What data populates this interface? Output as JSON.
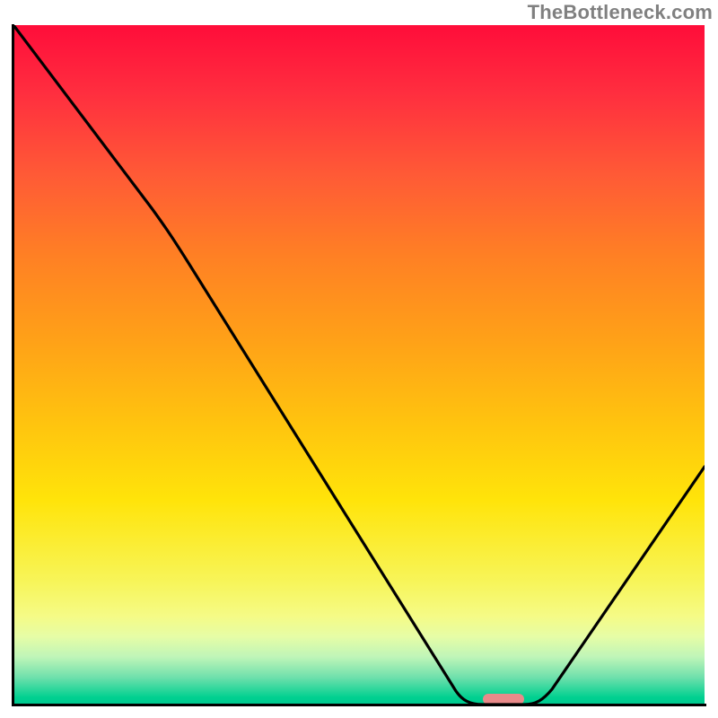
{
  "watermark": "TheBottleneck.com",
  "colors": {
    "gradient_top": "#ff0d3a",
    "gradient_bottom": "#00c890",
    "axis": "#000000",
    "curve": "#000000",
    "marker": "#e98a8a",
    "watermark": "#808080"
  },
  "chart_data": {
    "type": "line",
    "title": "",
    "xlabel": "",
    "ylabel": "",
    "xlim": [
      0,
      100
    ],
    "ylim": [
      0,
      100
    ],
    "x": [
      0,
      20,
      64,
      68,
      74,
      100
    ],
    "values": [
      100,
      73,
      2,
      0,
      0,
      35
    ],
    "marker": {
      "x_start": 68,
      "x_end": 74,
      "y": 0
    },
    "background": "rainbow-vertical-gradient"
  }
}
